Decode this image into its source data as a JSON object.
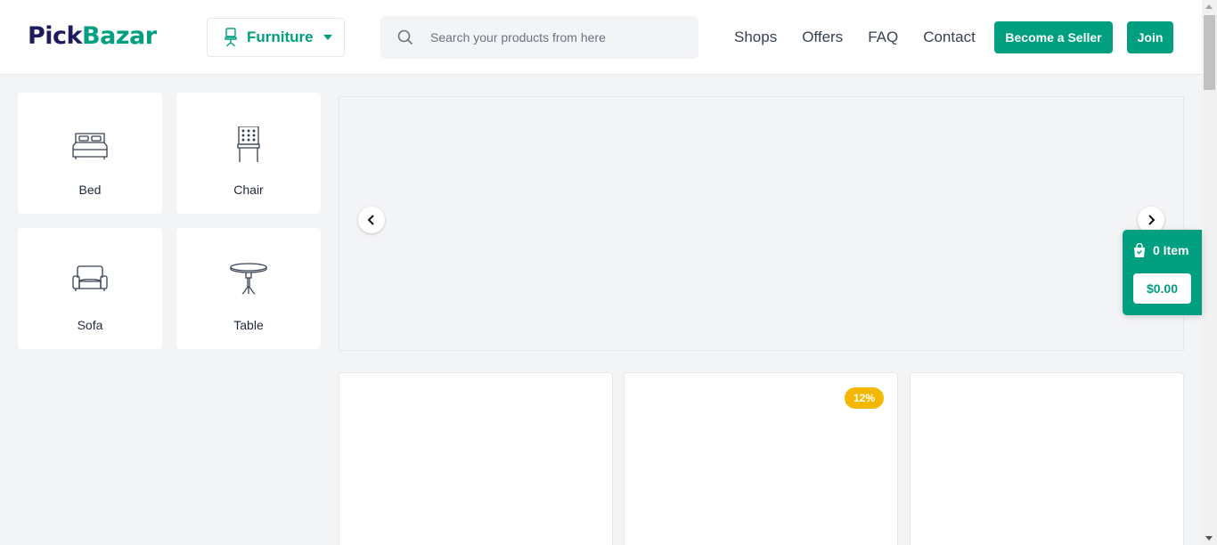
{
  "header": {
    "logo_part1": "Pick",
    "logo_part2": "Bazar",
    "type_selector": {
      "label": "Furniture",
      "icon": "chair-icon"
    },
    "search": {
      "placeholder": "Search your products from here",
      "value": ""
    },
    "nav": [
      "Shops",
      "Offers",
      "FAQ",
      "Contact"
    ],
    "become_seller_label": "Become a Seller",
    "join_label": "Join"
  },
  "categories": [
    {
      "label": "Bed",
      "icon": "bed-icon"
    },
    {
      "label": "Chair",
      "icon": "chair-icon"
    },
    {
      "label": "Sofa",
      "icon": "sofa-icon"
    },
    {
      "label": "Table",
      "icon": "table-icon"
    }
  ],
  "cart": {
    "items_label": "0 Item",
    "total": "$0.00"
  },
  "products": [
    {
      "discount": ""
    },
    {
      "discount": "12%"
    },
    {
      "discount": ""
    }
  ],
  "colors": {
    "accent": "#009f7f",
    "logo_dark": "#1e1b5e",
    "badge": "#f5b800",
    "background": "#f3f4f6"
  }
}
